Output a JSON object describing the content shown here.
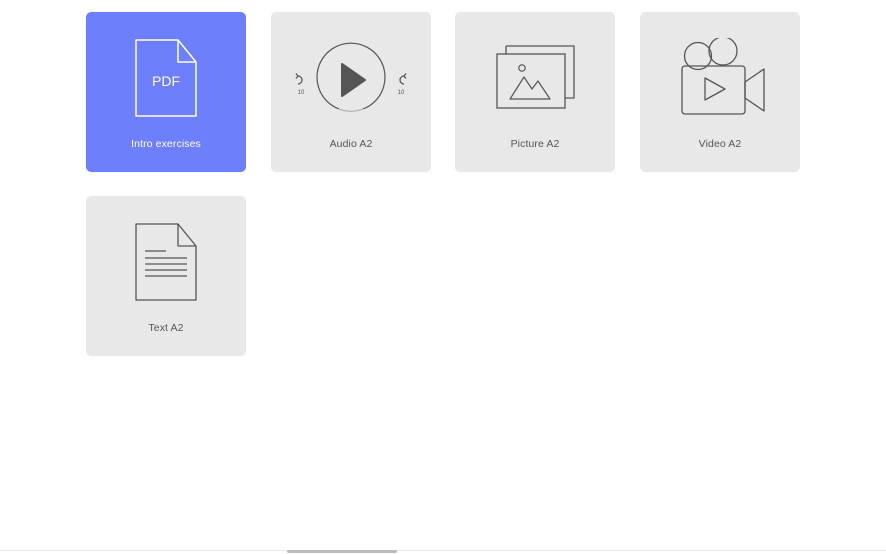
{
  "tiles": [
    {
      "label": "Intro exercises",
      "icon": "pdf-file-icon",
      "file_badge": "PDF",
      "active": true
    },
    {
      "label": "Audio A2",
      "icon": "audio-player-icon",
      "skip_back": "10",
      "skip_forward": "10",
      "active": false
    },
    {
      "label": "Picture A2",
      "icon": "picture-icon",
      "active": false
    },
    {
      "label": "Video A2",
      "icon": "video-camera-icon",
      "active": false
    },
    {
      "label": "Text A2",
      "icon": "text-document-icon",
      "active": false
    }
  ],
  "colors": {
    "accent": "#6e7ffb",
    "tile_background": "#e8e8e8",
    "icon_stroke": "#555555",
    "active_text": "#ffffff"
  }
}
